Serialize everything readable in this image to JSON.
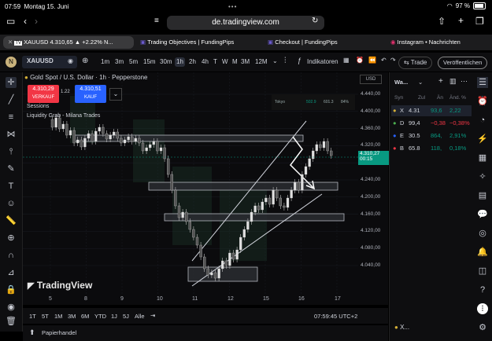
{
  "status": {
    "time": "07:59",
    "date": "Montag 15. Juni",
    "battery": "97 %"
  },
  "browser": {
    "url": "de.tradingview.com"
  },
  "tabs": [
    {
      "label": "XAUUSD 4.310,65 ▲ +2.22% N..."
    },
    {
      "label": "Trading Objectives | FundingPips"
    },
    {
      "label": "Checkout | FundingPips"
    },
    {
      "label": "Instagram • Nachrichten"
    }
  ],
  "toolbar": {
    "symbol": "XAUUSD",
    "timeframes": [
      "1m",
      "3m",
      "5m",
      "15m",
      "30m",
      "1h",
      "2h",
      "4h",
      "T",
      "W",
      "M",
      "3M",
      "12M"
    ],
    "selected_tf": "1h",
    "indicators": "Indikatoren",
    "trade": "Trade",
    "publish": "Veröffentlichen"
  },
  "chart": {
    "title": "Gold Spot / U.S. Dollar · 1h · Pepperstone",
    "sell_price": "4.310,29",
    "sell_label": "VERKAUF",
    "spread": "1.22",
    "buy_price": "4.310,51",
    "buy_label": "KAUF",
    "indicator1": "Sessions",
    "indicator2": "Liquidity Grab - Milana Trades",
    "currency": "USD",
    "session_table": {
      "name": "Tokyo",
      "v1": "502.9",
      "v2": "601.3",
      "v3": "84%"
    },
    "watermark": "TradingView",
    "last_price": "4.310,27",
    "countdown": "00:15",
    "y_ticks": [
      "4.440,00",
      "4.400,00",
      "4.360,00",
      "4.320,00",
      "4.280,00",
      "4.240,00",
      "4.200,00",
      "4.160,00",
      "4.120,00",
      "4.080,00",
      "4.040,00"
    ],
    "x_ticks": [
      "5",
      "8",
      "9",
      "10",
      "11",
      "12",
      "15",
      "16",
      "17"
    ]
  },
  "bottom": {
    "ranges": [
      "1T",
      "5T",
      "1M",
      "3M",
      "6M",
      "YTD",
      "1J",
      "5J",
      "Alle"
    ],
    "clock": "07:59:45 UTC+2",
    "paper": "Papierhandel"
  },
  "watchlist": {
    "title": "Wa...",
    "headers": [
      "Syn",
      "Zul",
      "Än",
      "Änd. %"
    ],
    "rows": [
      {
        "sym": "X",
        "last": "4.31",
        "chg": "93,6",
        "pct": "2,22",
        "dir": "up"
      },
      {
        "sym": "D",
        "last": "99,4",
        "chg": "−0,38",
        "pct": "−0,38%",
        "dir": "down"
      },
      {
        "sym": "E",
        "last": "30.5",
        "chg": "864,",
        "pct": "2,91%",
        "dir": "up"
      },
      {
        "sym": "B",
        "last": "65.8",
        "chg": "118,",
        "pct": "0,18%",
        "dir": "up"
      }
    ],
    "footer_sym": "X..."
  },
  "colors": {
    "up": "#089981",
    "down": "#f23645",
    "accent": "#2962ff"
  }
}
